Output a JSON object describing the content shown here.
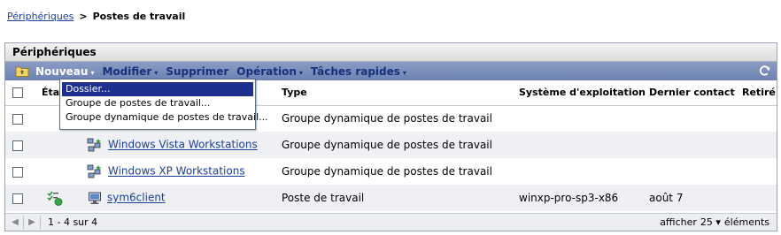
{
  "breadcrumb": {
    "parent": "Périphériques",
    "separator": ">",
    "current": "Postes de travail"
  },
  "panel": {
    "title": "Périphériques"
  },
  "toolbar": {
    "items": [
      {
        "label": "Nouveau",
        "open": true
      },
      {
        "label": "Modifier"
      },
      {
        "label": "Supprimer"
      },
      {
        "label": "Opération"
      },
      {
        "label": "Tâches rapides"
      }
    ],
    "caret": "▾"
  },
  "menu": {
    "items": [
      "Dossier...",
      "Groupe de postes de travail...",
      "Groupe dynamique de postes de travail..."
    ],
    "selected": 0
  },
  "table": {
    "columns": {
      "status": "État",
      "type": "Type",
      "os": "Système d'exploitation",
      "last_contact": "Dernier contact",
      "retired": "Retiré"
    },
    "rows": [
      {
        "name": "",
        "type": "Groupe dynamique de postes de travail",
        "os": "",
        "last_contact": "",
        "icon": "",
        "status_icon": ""
      },
      {
        "name": "Windows Vista Workstations",
        "type": "Groupe dynamique de postes de travail",
        "os": "",
        "last_contact": "",
        "icon": "dynamic-group-icon",
        "status_icon": ""
      },
      {
        "name": "Windows XP Workstations",
        "type": "Groupe dynamique de postes de travail",
        "os": "",
        "last_contact": "",
        "icon": "dynamic-group-icon",
        "status_icon": ""
      },
      {
        "name": "sym6client",
        "type": "Poste de travail",
        "os": "winxp-pro-sp3-x86",
        "last_contact": "août 7",
        "icon": "workstation-icon",
        "status_icon": "status-ok-icon"
      }
    ]
  },
  "footer": {
    "range": "1 - 4 sur 4",
    "show_label": "afficher",
    "page_size": "25",
    "items_label": "éléments"
  },
  "colors": {
    "toolbar": "#7185b6",
    "link": "#1a3f99",
    "selection": "#1d2f8f"
  }
}
